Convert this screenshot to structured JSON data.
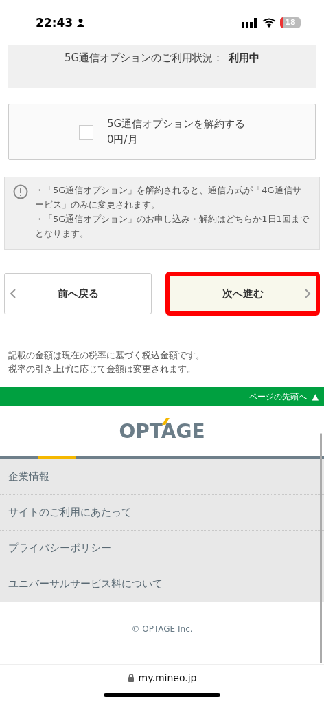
{
  "status_bar": {
    "time": "22:43",
    "battery": "18"
  },
  "usage": {
    "label": "5G通信オプションのご利用状況：",
    "value": "利用中"
  },
  "option": {
    "checked": false,
    "title": "5G通信オプションを解約する",
    "price": "0円/月"
  },
  "notice": {
    "lines": [
      "・「5G通信オプション」を解約されると、通信方式が「4G通信サービス」のみに変更されます。",
      "・「5G通信オプション」のお申し込み・解約はどちらか1日1回までとなります。"
    ]
  },
  "buttons": [
    {
      "kind": "back",
      "label": "前へ戻る",
      "highlighted": false
    },
    {
      "kind": "next",
      "label": "次へ進む",
      "highlighted": true
    }
  ],
  "tax_note": [
    "記載の金額は現在の税率に基づく税込金額です。",
    "税率の引き上げに応じて金額は変更されます。"
  ],
  "page_top": {
    "label": "ページの先頭へ",
    "arrow": "▲"
  },
  "footer": {
    "logo": "OPTAGE",
    "links": [
      "企業情報",
      "サイトのご利用にあたって",
      "プライバシーポリシー",
      "ユニバーサルサービス料について"
    ],
    "copyright": "© OPTAGE Inc."
  },
  "url_bar": {
    "url": "my.mineo.jp"
  }
}
